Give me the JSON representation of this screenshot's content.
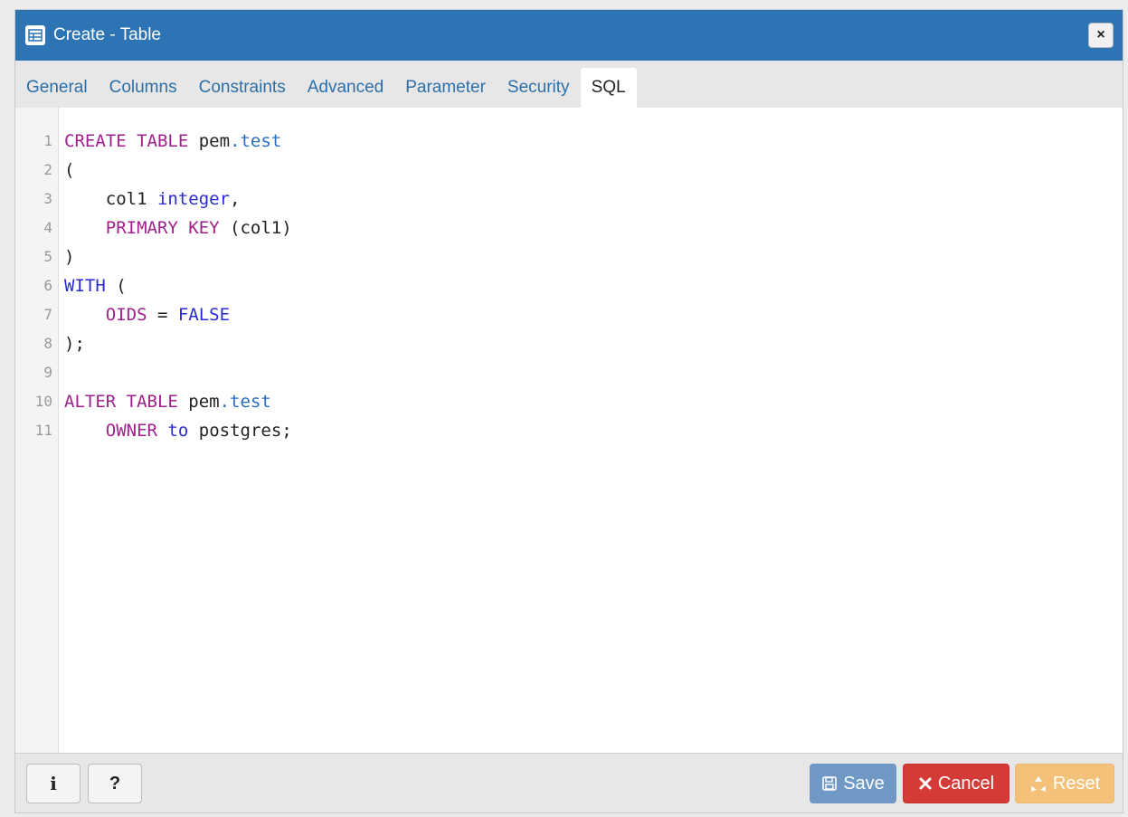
{
  "window": {
    "title": "Create - Table",
    "close_label": "×"
  },
  "tabs": [
    {
      "label": "General"
    },
    {
      "label": "Columns"
    },
    {
      "label": "Constraints"
    },
    {
      "label": "Advanced"
    },
    {
      "label": "Parameter"
    },
    {
      "label": "Security"
    },
    {
      "label": "SQL",
      "active": true
    }
  ],
  "editor": {
    "line_numbers": [
      "1",
      "2",
      "3",
      "4",
      "5",
      "6",
      "7",
      "8",
      "9",
      "10",
      "11"
    ],
    "lines": [
      [
        {
          "t": "CREATE TABLE",
          "c": "kw"
        },
        {
          "t": " pem",
          "c": "pl"
        },
        {
          "t": ".test",
          "c": "fn"
        }
      ],
      [
        {
          "t": "(",
          "c": "pl"
        }
      ],
      [
        {
          "t": "    col1 ",
          "c": "pl"
        },
        {
          "t": "integer",
          "c": "bl"
        },
        {
          "t": ",",
          "c": "pl"
        }
      ],
      [
        {
          "t": "    ",
          "c": "pl"
        },
        {
          "t": "PRIMARY KEY",
          "c": "kw"
        },
        {
          "t": " (col1)",
          "c": "pl"
        }
      ],
      [
        {
          "t": ")",
          "c": "pl"
        }
      ],
      [
        {
          "t": "WITH",
          "c": "bl"
        },
        {
          "t": " (",
          "c": "pl"
        }
      ],
      [
        {
          "t": "    ",
          "c": "pl"
        },
        {
          "t": "OIDS",
          "c": "kw"
        },
        {
          "t": " = ",
          "c": "pl"
        },
        {
          "t": "FALSE",
          "c": "bl"
        }
      ],
      [
        {
          "t": ");",
          "c": "pl"
        }
      ],
      [],
      [
        {
          "t": "ALTER TABLE",
          "c": "kw"
        },
        {
          "t": " pem",
          "c": "pl"
        },
        {
          "t": ".test",
          "c": "fn"
        }
      ],
      [
        {
          "t": "    ",
          "c": "pl"
        },
        {
          "t": "OWNER",
          "c": "kw"
        },
        {
          "t": " ",
          "c": "pl"
        },
        {
          "t": "to",
          "c": "bl"
        },
        {
          "t": " postgres;",
          "c": "pl"
        }
      ]
    ]
  },
  "footer": {
    "info_label": "i",
    "help_label": "?",
    "save_label": "Save",
    "cancel_label": "Cancel",
    "reset_label": "Reset"
  },
  "colors": {
    "titlebar": "#2c74b4",
    "keyword": "#a1218c",
    "builtin": "#2a2bd6",
    "save": "#6f98c4",
    "cancel": "#d43b36",
    "reset": "#f3c17a"
  },
  "icons": {
    "title": "table-icon",
    "save": "floppy-disk-icon",
    "cancel": "x-icon",
    "reset": "recycle-icon"
  }
}
